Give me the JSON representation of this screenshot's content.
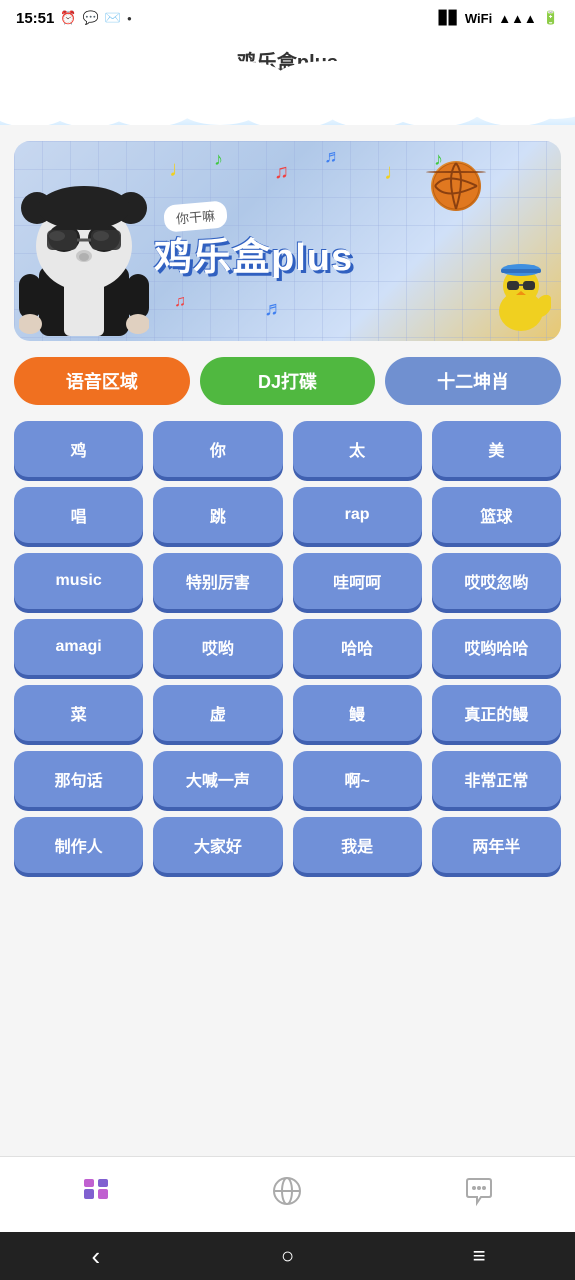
{
  "statusBar": {
    "time": "15:51",
    "icons": [
      "alarm",
      "message",
      "email",
      "dot"
    ]
  },
  "header": {
    "title": "鸡乐盒plus"
  },
  "banner": {
    "subtitle": "你干嘛",
    "title": "鸡乐盒plus",
    "musicNotes": [
      "♩",
      "♪",
      "♫",
      "♬",
      "♩",
      "♪"
    ]
  },
  "categories": [
    {
      "id": "voice",
      "label": "语音区域",
      "style": "orange"
    },
    {
      "id": "dj",
      "label": "DJ打碟",
      "style": "green"
    },
    {
      "id": "zodiac",
      "label": "十二坤肖",
      "style": "blue"
    }
  ],
  "sounds": [
    "鸡",
    "你",
    "太",
    "美",
    "唱",
    "跳",
    "rap",
    "篮球",
    "music",
    "特别厉害",
    "哇呵呵",
    "哎哎忽哟",
    "amagi",
    "哎哟",
    "哈哈",
    "哎哟哈哈",
    "菜",
    "虚",
    "鳗",
    "真正的鳗",
    "那句话",
    "大喊一声",
    "啊~",
    "非常正常",
    "制作人",
    "大家好",
    "我是",
    "两年半"
  ],
  "bottomNav": [
    {
      "id": "home",
      "label": "",
      "active": true
    },
    {
      "id": "explore",
      "label": "",
      "active": false
    },
    {
      "id": "chat",
      "label": "",
      "active": false
    }
  ],
  "sysNav": {
    "back": "‹",
    "home": "○",
    "menu": "≡"
  }
}
